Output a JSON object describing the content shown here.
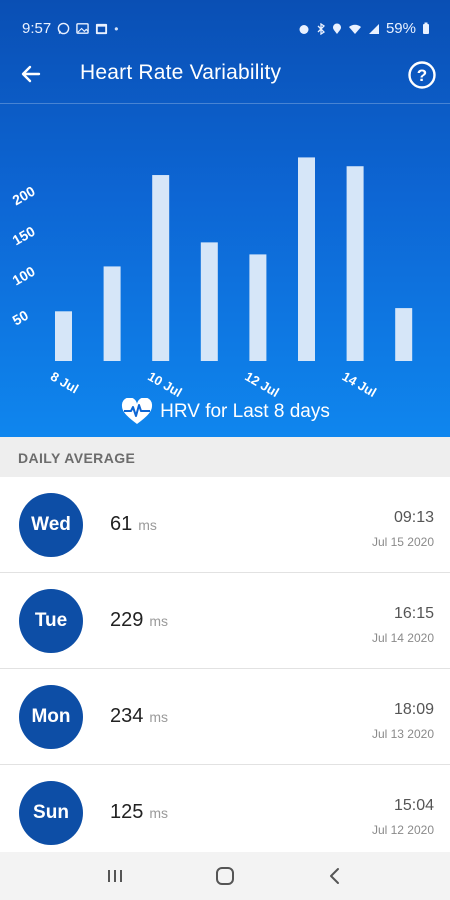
{
  "status_bar": {
    "time": "9:57",
    "battery": "59%",
    "left_icons": [
      "whatsapp-icon",
      "image-icon",
      "calendar-icon",
      "dot-icon"
    ],
    "right_icons": [
      "alarm-icon",
      "bluetooth-icon",
      "location-icon",
      "wifi-icon",
      "signal-icon",
      "battery-icon"
    ]
  },
  "app_bar": {
    "title": "Heart Rate Variability",
    "back_icon": "arrow-left-icon",
    "help_icon": "question-circle-icon"
  },
  "colors": {
    "header_gradient_top": "#0a4fb4",
    "header_gradient_bottom": "#0f86ee",
    "bar_fill": "#d6e6f8",
    "day_circle": "#0d4ea6"
  },
  "chart_data": {
    "type": "bar",
    "x": [
      "8 Jul",
      "9 Jul",
      "10 Jul",
      "11 Jul",
      "12 Jul",
      "13 Jul",
      "14 Jul",
      "15 Jul"
    ],
    "values": [
      62,
      118,
      232,
      148,
      133,
      254,
      243,
      66
    ],
    "x_tick_labels": [
      "8 Jul",
      "10 Jul",
      "12 Jul",
      "14 Jul"
    ],
    "y_tick_labels": [
      "50",
      "100",
      "150",
      "200"
    ],
    "y_ticks": [
      50,
      100,
      150,
      200
    ],
    "ylim": [
      0,
      262
    ],
    "grid": false
  },
  "caption": {
    "text": "HRV for Last 8 days",
    "icon": "heart-pulse-icon"
  },
  "section": {
    "title": "DAILY AVERAGE"
  },
  "daily": [
    {
      "day": "Wed",
      "value": "61",
      "unit": "ms",
      "time": "09:13",
      "date": "Jul 15 2020"
    },
    {
      "day": "Tue",
      "value": "229",
      "unit": "ms",
      "time": "16:15",
      "date": "Jul 14 2020"
    },
    {
      "day": "Mon",
      "value": "234",
      "unit": "ms",
      "time": "18:09",
      "date": "Jul 13 2020"
    },
    {
      "day": "Sun",
      "value": "125",
      "unit": "ms",
      "time": "15:04",
      "date": "Jul 12 2020"
    }
  ],
  "nav_bar": {
    "recents_icon": "recents-icon",
    "home_icon": "home-icon",
    "back_icon": "chevron-left-icon"
  }
}
